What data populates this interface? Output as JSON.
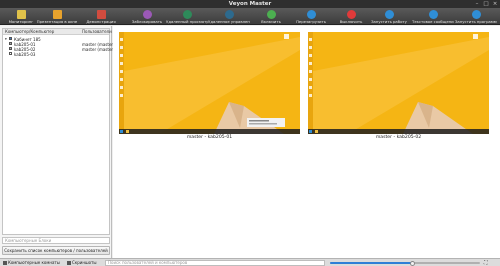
{
  "window": {
    "title": "Veyon Master"
  },
  "toolbar": {
    "buttons": [
      {
        "label": "Мониторинг",
        "icon": "monitor-grid-icon",
        "color": "#e0c24a",
        "shape": "square"
      },
      {
        "label": "Презентация в окне",
        "icon": "window-presentation-icon",
        "color": "#e8a22c",
        "shape": "square"
      },
      {
        "label": "Демонстрация",
        "icon": "demo-icon",
        "color": "#d24c3f",
        "shape": "square"
      },
      {
        "label": "Заблокировать",
        "icon": "lock-icon",
        "color": "#9b59b6",
        "shape": "circle"
      },
      {
        "label": "Удаленный просмотр",
        "icon": "remote-view-icon",
        "color": "#2e8a5a",
        "shape": "circle"
      },
      {
        "label": "Удаленное управление",
        "icon": "remote-control-icon",
        "color": "#2d6a8e",
        "shape": "circle"
      },
      {
        "label": "Включить",
        "icon": "power-on-icon",
        "color": "#4caf50",
        "shape": "circle"
      },
      {
        "label": "Перезагрузить",
        "icon": "reboot-icon",
        "color": "#2f8ed6",
        "shape": "circle"
      },
      {
        "label": "Выключить",
        "icon": "power-off-icon",
        "color": "#e03a3a",
        "shape": "circle"
      },
      {
        "label": "Запустить работу",
        "icon": "run-program-icon",
        "color": "#2f8ed6",
        "shape": "circle"
      },
      {
        "label": "Текстовое сообщение",
        "icon": "text-message-icon",
        "color": "#2f8ed6",
        "shape": "circle"
      },
      {
        "label": "Запустить программу",
        "icon": "open-website-icon",
        "color": "#2f8ed6",
        "shape": "circle"
      }
    ]
  },
  "tree": {
    "col_computer": "Компьютер/Компьютер",
    "col_user": "Пользователи",
    "group": "Кабинет 185",
    "rows": [
      {
        "name": "kab205-01",
        "user": "master (master)"
      },
      {
        "name": "kab205-02",
        "user": "master (master)"
      },
      {
        "name": "kab205-03",
        "user": ""
      }
    ]
  },
  "left": {
    "search_placeholder": "Компьютерные Блоки",
    "save_label": "Сохранить список компьютеров / пользователей"
  },
  "screens": [
    {
      "caption": "master - kab205-01"
    },
    {
      "caption": "master - kab205-02"
    }
  ],
  "bottom": {
    "computers_label": "Компьютерные комнаты",
    "screenshots_label": "Скриншоты",
    "search_placeholder": "Поиск пользователей и компьютеров",
    "zoom_fraction": 0.55
  }
}
